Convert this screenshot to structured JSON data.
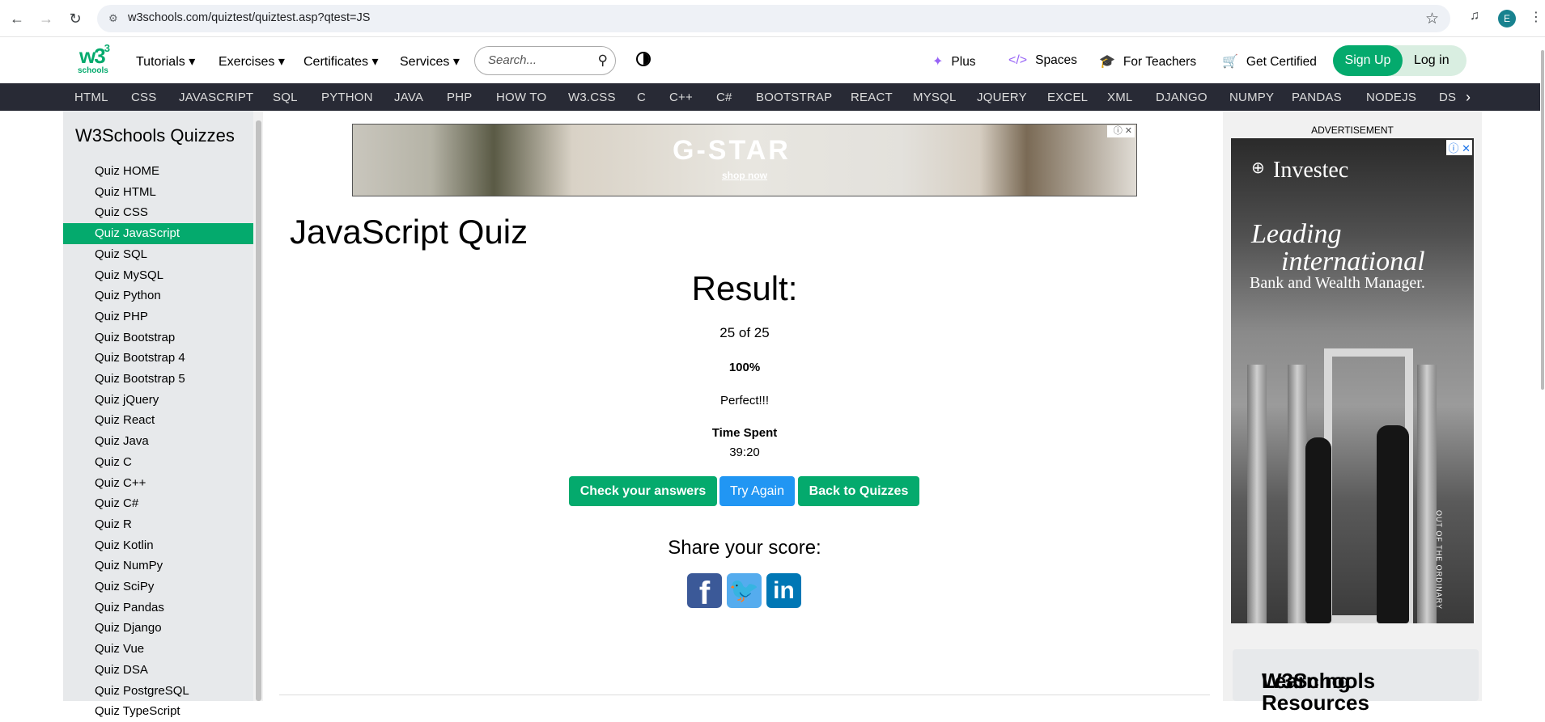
{
  "browser": {
    "url": "w3schools.com/quiztest/quiztest.asp?qtest=JS",
    "profile_initial": "E"
  },
  "logo": {
    "brand": "w3",
    "sup": "3",
    "sub": "schools"
  },
  "topnav": {
    "menus": [
      "Tutorials",
      "Exercises",
      "Certificates",
      "Services"
    ],
    "search_placeholder": "Search...",
    "links": [
      {
        "icon": "sparkle-icon",
        "label": "Plus"
      },
      {
        "icon": "code-icon",
        "label": "Spaces"
      },
      {
        "icon": "graduation-cap-icon",
        "label": "For Teachers"
      },
      {
        "icon": "cart-icon",
        "label": "Get Certified"
      }
    ],
    "signup": "Sign Up",
    "login": "Log in"
  },
  "subjects": [
    "HTML",
    "CSS",
    "JAVASCRIPT",
    "SQL",
    "PYTHON",
    "JAVA",
    "PHP",
    "HOW TO",
    "W3.CSS",
    "C",
    "C++",
    "C#",
    "BOOTSTRAP",
    "REACT",
    "MYSQL",
    "JQUERY",
    "EXCEL",
    "XML",
    "DJANGO",
    "NUMPY",
    "PANDAS",
    "NODEJS",
    "DS"
  ],
  "sidebar": {
    "title": "W3Schools Quizzes",
    "items": [
      "Quiz HOME",
      "Quiz HTML",
      "Quiz CSS",
      "Quiz JavaScript",
      "Quiz SQL",
      "Quiz MySQL",
      "Quiz Python",
      "Quiz PHP",
      "Quiz Bootstrap",
      "Quiz Bootstrap 4",
      "Quiz Bootstrap 5",
      "Quiz jQuery",
      "Quiz React",
      "Quiz Java",
      "Quiz C",
      "Quiz C++",
      "Quiz C#",
      "Quiz R",
      "Quiz Kotlin",
      "Quiz NumPy",
      "Quiz SciPy",
      "Quiz Pandas",
      "Quiz Django",
      "Quiz Vue",
      "Quiz DSA",
      "Quiz PostgreSQL",
      "Quiz TypeScript"
    ],
    "active_index": 3
  },
  "ad_top": {
    "brand": "G-STAR",
    "cta": "shop now",
    "adchoices": "ⓘ ✕"
  },
  "main": {
    "title": "JavaScript Quiz",
    "result_title": "Result:",
    "score": "25 of 25",
    "percent": "100%",
    "verdict": "Perfect!!!",
    "time_label": "Time Spent",
    "time_value": "39:20",
    "buttons": {
      "check": "Check your answers",
      "retry": "Try Again",
      "back": "Back to Quizzes"
    },
    "share_title": "Share your score:",
    "social": {
      "facebook": "f",
      "twitter": "🐦",
      "linkedin": "in"
    }
  },
  "right_ad": {
    "label": "ADVERTISEMENT",
    "brand": "Investec",
    "headline1": "Leading",
    "headline2": "international",
    "headline3": "Bank and Wealth Manager.",
    "vertical": "OUT OF THE ORDINARY",
    "adchoices": "ⓘ ✕"
  },
  "learn_box": {
    "line1": "W3Schools",
    "line2": "Learning Resources"
  }
}
